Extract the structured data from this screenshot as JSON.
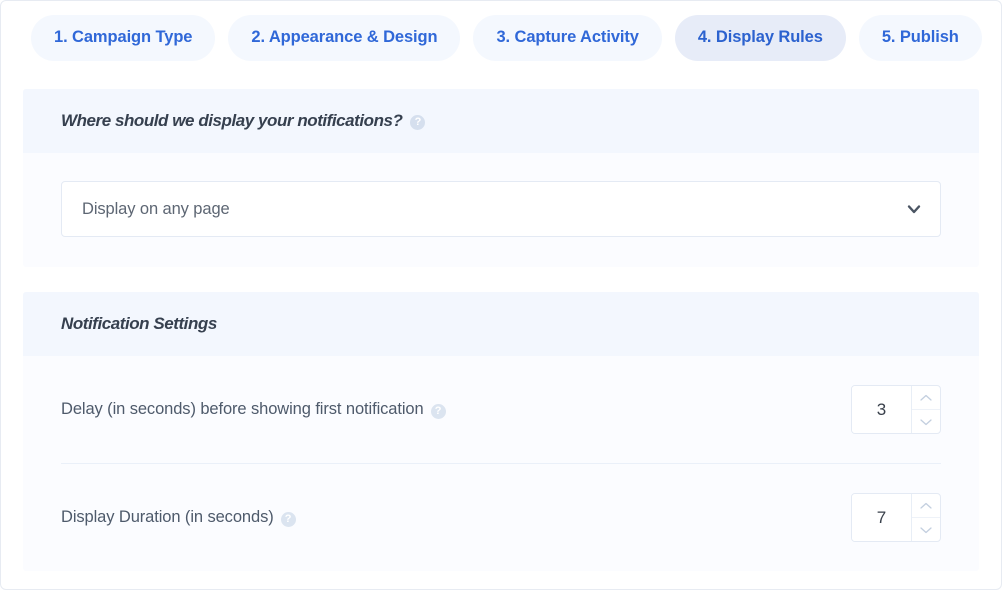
{
  "steps": {
    "tabs": [
      {
        "label": "1. Campaign Type",
        "active": false
      },
      {
        "label": "2. Appearance & Design",
        "active": false
      },
      {
        "label": "3. Capture Activity",
        "active": false
      },
      {
        "label": "4. Display Rules",
        "active": true
      },
      {
        "label": "5. Publish",
        "active": false
      }
    ]
  },
  "display_location": {
    "header_title": "Where should we display your notifications?",
    "header_help": "?",
    "select": {
      "value": "Display on any page",
      "chevron": "chevron-down"
    }
  },
  "notification_settings": {
    "header_title": "Notification Settings",
    "rows": [
      {
        "label": "Delay (in seconds) before showing first notification",
        "help": "?",
        "value": "3"
      },
      {
        "label": "Display Duration (in seconds)",
        "help": "?",
        "value": "7"
      }
    ]
  },
  "colors": {
    "tab_bg": "#f4f8fe",
    "tab_active_bg": "#e7ecf8",
    "tab_text": "#3068d8",
    "card_header_bg": "#f3f7fe",
    "card_bg": "#fbfcff",
    "heading_text": "#36404f",
    "label_text": "#4e5a6b",
    "border": "#e4eaf4"
  }
}
